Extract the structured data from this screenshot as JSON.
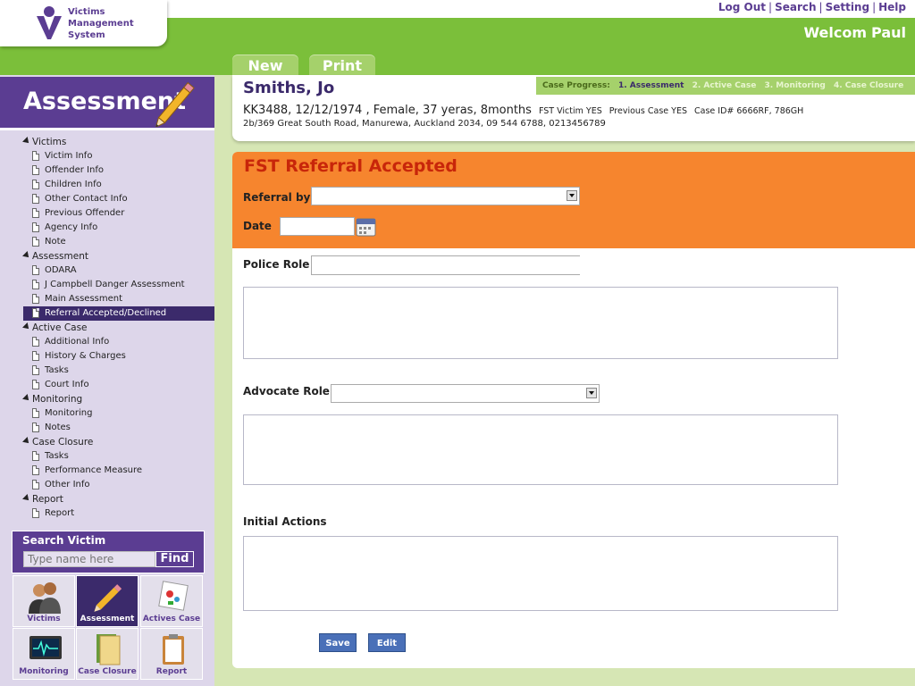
{
  "logo": {
    "line1": "Victims",
    "line2": "Management",
    "line3": "System"
  },
  "top_links": [
    "Log Out",
    "Search",
    "Setting",
    "Help"
  ],
  "welcome": {
    "prefix": "Welcom",
    "name": "Paul"
  },
  "tabs": {
    "new": "New",
    "print": "Print"
  },
  "sidebar": {
    "title": "Assessment",
    "groups": [
      {
        "label": "Victims",
        "items": [
          "Victim Info",
          "Offender Info",
          "Children Info",
          "Other Contact Info",
          "Previous Offender",
          "Agency Info",
          "Note"
        ]
      },
      {
        "label": "Assessment",
        "items": [
          "ODARA",
          "J Campbell Danger Assessment",
          "Main Assessment",
          "Referral Accepted/Declined"
        ]
      },
      {
        "label": "Active Case",
        "items": [
          "Additional Info",
          "History & Charges",
          "Tasks",
          "Court Info"
        ]
      },
      {
        "label": "Monitoring",
        "items": [
          "Monitoring",
          "Notes"
        ]
      },
      {
        "label": "Case Closure",
        "items": [
          "Tasks",
          "Performance Measure",
          "Other Info"
        ]
      },
      {
        "label": "Report",
        "items": [
          "Report"
        ]
      }
    ],
    "active_item": "Referral Accepted/Declined"
  },
  "search": {
    "label": "Search Victim",
    "placeholder": "Type name here",
    "button": "Find"
  },
  "tiles": [
    {
      "label": "Victims",
      "icon": "victims-icon"
    },
    {
      "label": "Assessment",
      "icon": "pencil-icon",
      "active": true
    },
    {
      "label": "Actives Case",
      "icon": "active-case-icon"
    },
    {
      "label": "Monitoring",
      "icon": "monitor-icon"
    },
    {
      "label": "Case Closure",
      "icon": "folder-icon"
    },
    {
      "label": "Report",
      "icon": "clipboard-icon"
    }
  ],
  "progress": {
    "label": "Case Progress:",
    "steps": [
      "1. Assessment",
      "2. Active Case",
      "3. Monitoring",
      "4. Case Closure"
    ]
  },
  "case": {
    "name": "Smiths, Jo",
    "details": "KK3488, 12/12/1974 , Female, 37 yeras, 8months",
    "fst": "FST Victim YES",
    "previous": "Previous Case YES",
    "case_id": "Case ID# 6666RF, 786GH",
    "address": "2b/369 Great South Road, Manurewa, Auckland 2034, 09 544 6788, 0213456789"
  },
  "form": {
    "title": "FST Referral Accepted",
    "referral_by_label": "Referral by",
    "referral_by_value": "",
    "date_label": "Date",
    "date_value": "",
    "police_role_label": "Police Role",
    "police_role_value": "",
    "advocate_role_label": "Advocate Role",
    "advocate_role_value": "",
    "initial_actions_label": "Initial Actions",
    "save_label": "Save",
    "edit_label": "Edit"
  },
  "colors": {
    "purple": "#5b3d92",
    "green": "#7bbf3a",
    "orange": "#f6852e",
    "light_green": "#a5d16b"
  }
}
